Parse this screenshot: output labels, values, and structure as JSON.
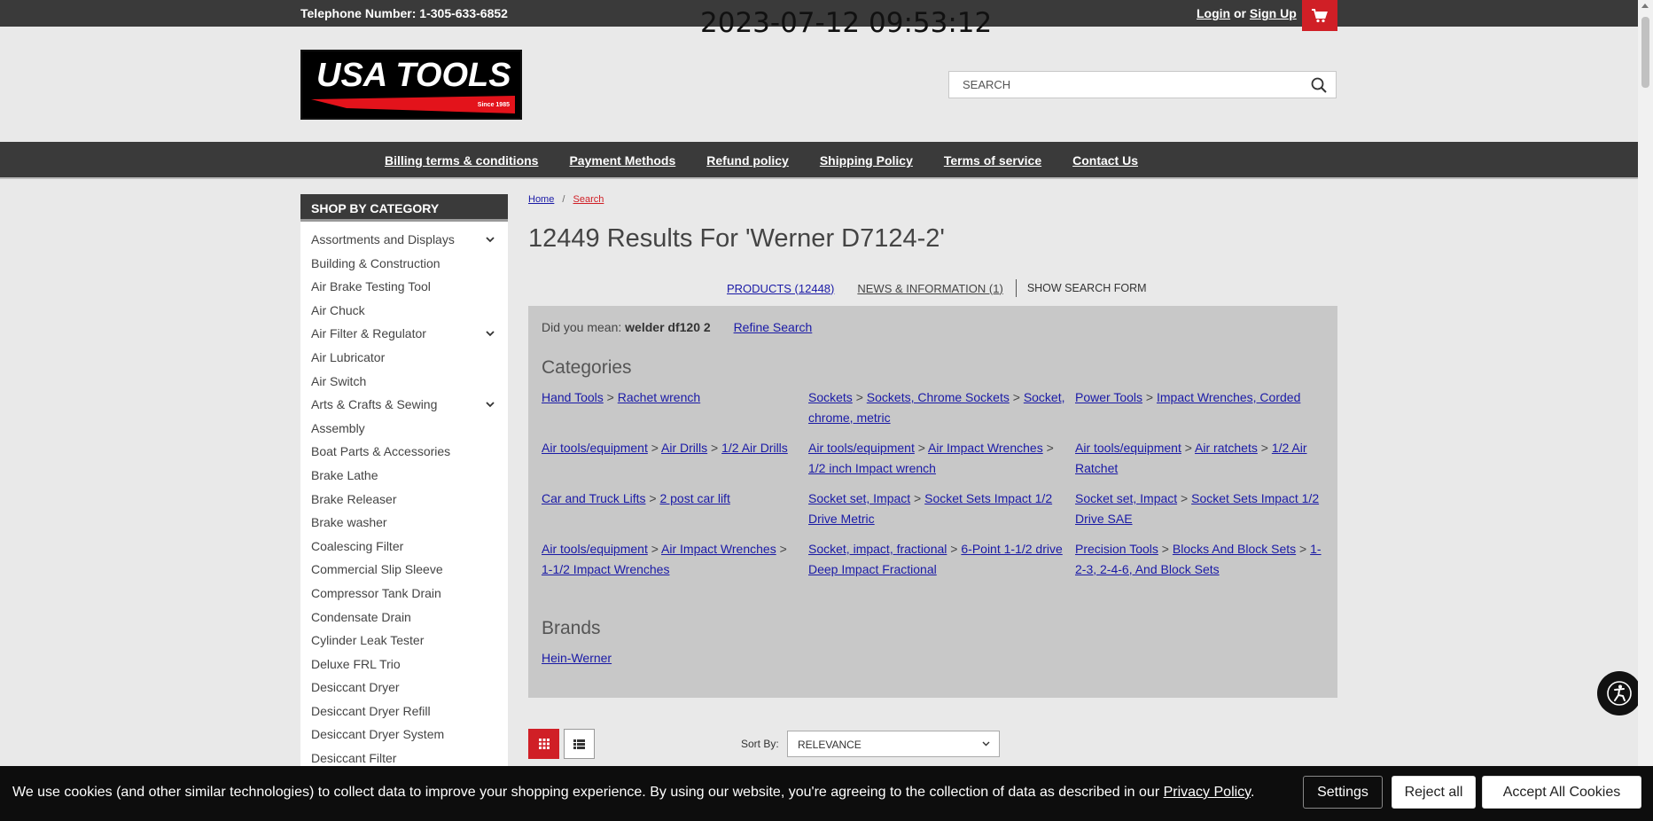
{
  "topbar": {
    "phone": "Telephone Number: 1-305-633-6852",
    "login": "Login",
    "or": "or",
    "signup": "Sign Up",
    "cart_icon": "cart-icon"
  },
  "timestamp": "2023-07-12 09:53:12",
  "logo": {
    "brand": "USA TOOLS",
    "since": "Since 1985"
  },
  "search": {
    "placeholder": "SEARCH",
    "icon": "search-icon"
  },
  "nav": {
    "items": [
      "Billing terms & conditions",
      "Payment Methods",
      "Refund policy",
      "Shipping Policy",
      "Terms of service",
      "Contact Us"
    ]
  },
  "sidebar": {
    "heading": "SHOP BY CATEGORY",
    "items": [
      {
        "label": "Assortments and Displays",
        "expandable": true
      },
      {
        "label": "Building & Construction",
        "expandable": false
      },
      {
        "label": "Air Brake Testing Tool",
        "expandable": false
      },
      {
        "label": "Air Chuck",
        "expandable": false
      },
      {
        "label": "Air Filter & Regulator",
        "expandable": true
      },
      {
        "label": "Air Lubricator",
        "expandable": false
      },
      {
        "label": "Air Switch",
        "expandable": false
      },
      {
        "label": "Arts & Crafts & Sewing",
        "expandable": true
      },
      {
        "label": "Assembly",
        "expandable": false
      },
      {
        "label": "Boat Parts & Accessories",
        "expandable": false
      },
      {
        "label": "Brake Lathe",
        "expandable": false
      },
      {
        "label": "Brake Releaser",
        "expandable": false
      },
      {
        "label": "Brake washer",
        "expandable": false
      },
      {
        "label": "Coalescing Filter",
        "expandable": false
      },
      {
        "label": "Commercial Slip Sleeve",
        "expandable": false
      },
      {
        "label": "Compressor Tank Drain",
        "expandable": false
      },
      {
        "label": "Condensate Drain",
        "expandable": false
      },
      {
        "label": "Cylinder Leak Tester",
        "expandable": false
      },
      {
        "label": "Deluxe FRL Trio",
        "expandable": false
      },
      {
        "label": "Desiccant Dryer",
        "expandable": false
      },
      {
        "label": "Desiccant Dryer Refill",
        "expandable": false
      },
      {
        "label": "Desiccant Dryer System",
        "expandable": false
      },
      {
        "label": "Desiccant Filter",
        "expandable": false
      }
    ]
  },
  "breadcrumb": {
    "home": "Home",
    "sep": "/",
    "current": "Search"
  },
  "results_title": "12449 Results For 'Werner D7124-2'",
  "tabs": {
    "products": "PRODUCTS (12448)",
    "news": "NEWS & INFORMATION (1)",
    "show_form": "SHOW SEARCH FORM"
  },
  "suggest": {
    "prefix": "Did you mean:",
    "term": "welder df120 2",
    "refine": "Refine Search"
  },
  "categories": {
    "heading": "Categories",
    "groups": [
      [
        "Hand Tools",
        "Rachet wrench"
      ],
      [
        "Sockets",
        "Sockets, Chrome Sockets",
        "Socket, chrome, metric"
      ],
      [
        "Power Tools",
        "Impact Wrenches, Corded"
      ],
      [
        "Air tools/equipment",
        "Air Drills",
        "1/2 Air Drills"
      ],
      [
        "Air tools/equipment",
        "Air Impact Wrenches",
        "1/2 inch Impact wrench"
      ],
      [
        "Air tools/equipment",
        "Air ratchets",
        "1/2 Air Ratchet"
      ],
      [
        "Car and Truck Lifts",
        "2 post car lift"
      ],
      [
        "Socket set, Impact",
        "Socket Sets Impact 1/2 Drive Metric"
      ],
      [
        "Socket set, Impact",
        "Socket Sets Impact 1/2 Drive SAE"
      ],
      [
        "Air tools/equipment",
        "Air Impact Wrenches",
        "1-1/2 Impact Wrenches"
      ],
      [
        "Socket, impact, fractional",
        "6-Point 1-1/2 drive Deep Impact Fractional"
      ],
      [
        "Precision Tools",
        "Blocks And Block Sets",
        "1-2-3, 2-4-6, And Block Sets"
      ]
    ]
  },
  "brands": {
    "heading": "Brands",
    "items": [
      "Hein-Werner"
    ]
  },
  "sort": {
    "label": "Sort By:",
    "value": "RELEVANCE"
  },
  "cookie": {
    "message": "We use cookies (and other similar technologies) to collect data to improve your shopping experience. By using our website, you're agreeing to the collection of data as described in our ",
    "policy_link": "Privacy Policy",
    "period": ".",
    "settings": "Settings",
    "reject": "Reject all",
    "accept": "Accept All Cookies"
  },
  "colors": {
    "accent": "#d01f26",
    "dark": "#3a3a3a",
    "link": "#1a1aa6"
  }
}
